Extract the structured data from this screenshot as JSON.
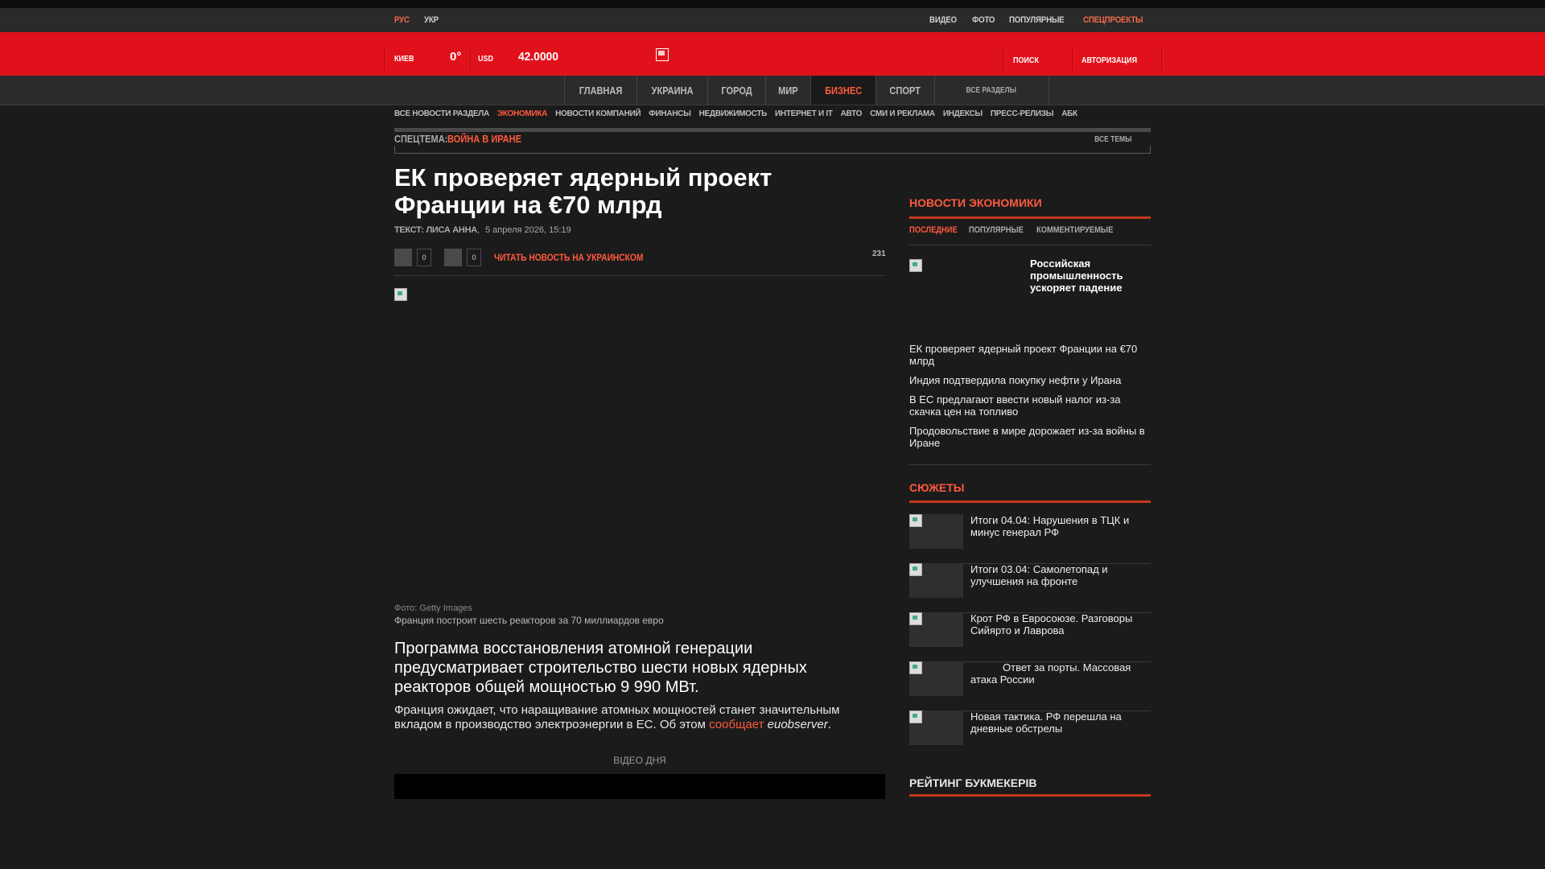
{
  "topbar": {
    "lang_ru": "РУС",
    "lang_ua": "УКР",
    "links": [
      "ВИДЕО",
      "ФОТО",
      "ПОПУЛЯРНЫЕ",
      "СПЕЦПРОЕКТЫ"
    ]
  },
  "header": {
    "city": "КИЕВ",
    "temperature": "0°",
    "currency": "USD",
    "rate": "42.0000",
    "search": "ПОИСК",
    "auth": "АВТОРИЗАЦИЯ"
  },
  "mainnav": [
    "ГЛАВНАЯ",
    "УКРАИНА",
    "ГОРОД",
    "МИР",
    "БИЗНЕС",
    "СПОРТ"
  ],
  "mainnav_active": "БИЗНЕС",
  "mainnav_all": "ВСЕ РАЗДЕЛЫ",
  "subnav": [
    "ВСЕ НОВОСТИ РАЗДЕЛА",
    "ЭКОНОМИКА",
    "НОВОСТИ КОМПАНИЙ",
    "ФИНАНСЫ",
    "НЕДВИЖИМОСТЬ",
    "ИНТЕРНЕТ И IT",
    "АВТО",
    "СМИ И РЕКЛАМА",
    "ИНДЕКСЫ",
    "ПРЕСС-РЕЛИЗЫ",
    "АБК"
  ],
  "subnav_active": "ЭКОНОМИКА",
  "special": {
    "label": "СПЕЦТЕМА:",
    "link": "ВОЙНА В ИРАНЕ",
    "all": "ВСЕ ТЕМЫ"
  },
  "article": {
    "title": "ЕК проверяет ядерный проект Франции на €70 млрд",
    "author": "ТЕКСТ: ЛИСА АННА",
    "date": "5 апреля 2026, 15:19",
    "likes_1": "0",
    "likes_2": "0",
    "read_ua": "ЧИТАТЬ НОВОСТЬ НА УКРАИНСКОМ",
    "views": "231",
    "photo_credit": "Фото: Getty Images",
    "photo_caption": "Франция построит шесть реакторов за 70 миллиардов евро",
    "lead": "Программа восстановления атомной генерации предусматривает строительство шести новых ядерных реакторов общей мощностью 9 990 МВт.",
    "para_text": "Франция ожидает, что наращивание атомных мощностей станет значительным вкладом в производство электроэнергии в ЕС. Об этом ",
    "para_link": "сообщает",
    "para_source": "euobserver",
    "para_end": ".",
    "video_label": "ВІДЕО ДНЯ"
  },
  "sidebar": {
    "news_title": "НОВОСТИ ЭКОНОМИКИ",
    "tabs": [
      "ПОСЛЕДНИЕ",
      "ПОПУЛЯРНЫЕ",
      "КОММЕНТИРУЕМЫЕ"
    ],
    "featured": "Российская промышленность ускоряет падение",
    "news": [
      "ЕК проверяет ядерный проект Франции на €70 млрд",
      "Индия подтвердила покупку нефти у Ирана",
      "В ЕС предлагают ввести новый налог из-за скачка цен на топливо",
      "Продовольствие в мире дорожает из-за войны в Иране"
    ],
    "stories_title": "СЮЖЕТЫ",
    "stories": [
      "Итоги 04.04: Нарушения в ТЦК и минус генерал РФ",
      "Итоги 03.04: Самолетопад и улучшения на фронте",
      "Крот РФ в Евросоюзе. Разговоры Сийярто и Лаврова",
      "Ответ за порты. Массовая атака России",
      "Новая тактика. РФ перешла на дневные обстрелы"
    ],
    "rating_title": "РЕЙТИНГ БУКМЕКЕРІВ"
  }
}
